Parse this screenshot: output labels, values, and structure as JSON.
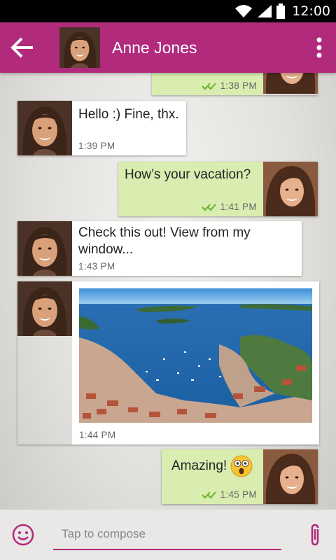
{
  "status_bar": {
    "time": "12:00"
  },
  "header": {
    "contact_name": "Anne Jones"
  },
  "messages": [
    {
      "direction": "outgoing",
      "text": "",
      "time": "1:38 PM"
    },
    {
      "direction": "incoming",
      "text": "Hello :) Fine, thx.",
      "time": "1:39 PM"
    },
    {
      "direction": "outgoing",
      "text": "How’s your vacation?",
      "time": "1:41 PM"
    },
    {
      "direction": "incoming",
      "text": "Check this out! View from my window...",
      "time": "1:43 PM"
    },
    {
      "direction": "incoming",
      "image": "harbor-photo",
      "time": "1:44 PM"
    },
    {
      "direction": "outgoing",
      "text": "Amazing!",
      "emoji": "surprised-face",
      "time": "1:45 PM"
    }
  ],
  "compose": {
    "placeholder": "Tap to compose"
  },
  "colors": {
    "accent": "#b12a7c",
    "outgoing_bubble": "#d9edb0",
    "incoming_bubble": "#ffffff",
    "read_ticks": "#6cb12c"
  }
}
